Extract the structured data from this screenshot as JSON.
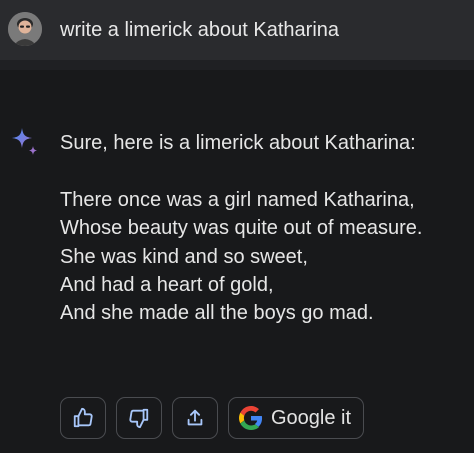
{
  "user": {
    "avatar_icon": "user-avatar-photo",
    "prompt": "write a limerick about Katharina"
  },
  "response": {
    "icon": "sparkle-icon",
    "intro": "Sure, here is a limerick about Katharina:",
    "poem_lines": [
      "There once was a girl named Katharina,",
      "Whose beauty was quite out of measure.",
      "She was kind and so sweet,",
      "And had a heart of gold,",
      "And she made all the boys go mad."
    ]
  },
  "actions": {
    "thumbs_up_icon": "thumbs-up-icon",
    "thumbs_down_icon": "thumbs-down-icon",
    "share_icon": "share-icon",
    "google_icon": "google-g-icon",
    "google_label": "Google it"
  },
  "colors": {
    "header_bg": "#2a2b2e",
    "response_bg": "#18191b",
    "text": "#e6e6e6",
    "sparkle_blue": "#4a8cf7",
    "sparkle_purple": "#9b72cb"
  }
}
